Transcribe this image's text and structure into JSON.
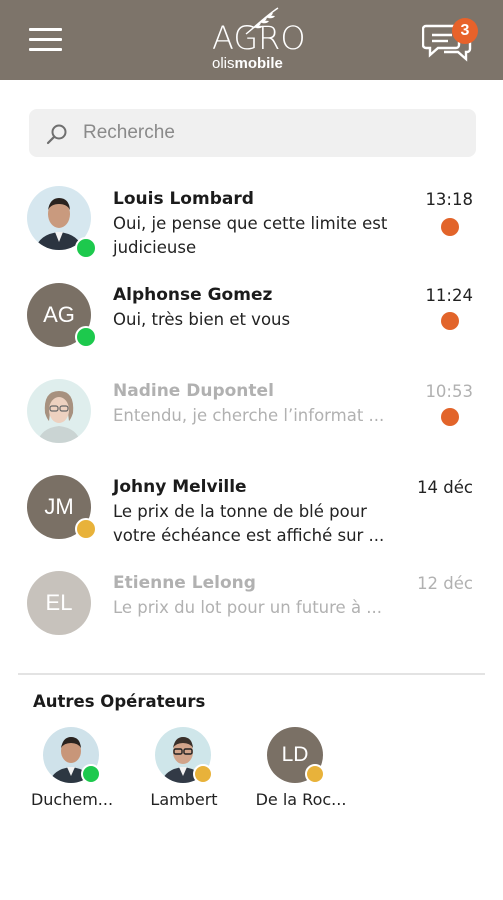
{
  "header": {
    "logo_word": "AGRO",
    "logo_sub_light": "olis",
    "logo_sub_bold": "mobile",
    "notification_count": "3",
    "colors": {
      "bar": "#7d746a",
      "badge": "#e8622a"
    }
  },
  "search": {
    "placeholder": "Recherche"
  },
  "conversations": [
    {
      "name": "Louis Lombard",
      "message": "Oui, je pense que cette limite est judicieuse",
      "time": "13:18",
      "unread": true,
      "status": "online",
      "avatar": "photo"
    },
    {
      "name": "Alphonse Gomez",
      "initials": "AG",
      "message": "Oui, très bien et vous",
      "time": "11:24",
      "unread": true,
      "status": "online",
      "avatar": "initials"
    },
    {
      "name": "Nadine Dupontel",
      "message": "Entendu, je cherche l’informat ...",
      "time": "10:53",
      "unread": true,
      "status": "none",
      "avatar": "photo",
      "read_style": true
    },
    {
      "name": "Johny Melville",
      "initials": "JM",
      "message": "Le prix de la tonne de blé pour votre échéance est affiché sur ...",
      "time": "14 déc",
      "unread": false,
      "status": "away",
      "avatar": "initials"
    },
    {
      "name": "Etienne Lelong",
      "initials": "EL",
      "message": "Le prix du lot pour un future à ...",
      "time": "12 déc",
      "unread": false,
      "status": "none",
      "avatar": "initials",
      "read_style": true
    }
  ],
  "operators_section": {
    "title": "Autres Opérateurs",
    "items": [
      {
        "label": "Duchem...",
        "status": "online",
        "avatar": "photo"
      },
      {
        "label": "Lambert",
        "status": "away",
        "avatar": "photo"
      },
      {
        "label": "De la Roc...",
        "initials": "LD",
        "status": "away",
        "avatar": "initials"
      }
    ]
  },
  "status_colors": {
    "online": "#1dc94d",
    "away": "#e8b23a",
    "unread": "#e2642a"
  }
}
